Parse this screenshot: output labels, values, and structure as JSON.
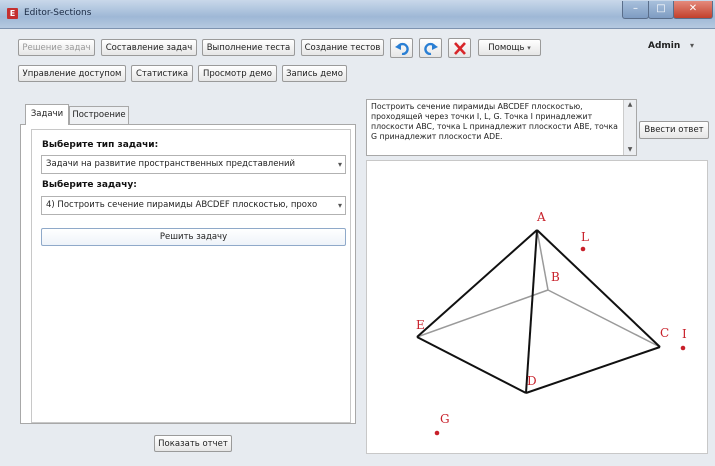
{
  "window": {
    "title": "Editor-Sections"
  },
  "toolbar": {
    "buttons": [
      {
        "label": "Решение задач",
        "enabled": false
      },
      {
        "label": "Составление задач",
        "enabled": true
      },
      {
        "label": "Выполнение теста",
        "enabled": true
      },
      {
        "label": "Создание тестов",
        "enabled": true
      }
    ],
    "help_label": "Помощь",
    "user_label": "Admin",
    "row2": [
      "Управление доступом",
      "Статистика",
      "Просмотр демо",
      "Запись демо"
    ]
  },
  "tabs": [
    {
      "label": "Задачи",
      "active": true
    },
    {
      "label": "Построение",
      "active": false
    }
  ],
  "task_panel": {
    "type_label": "Выберите тип задачи:",
    "type_value": "Задачи на развитие пространственных представлений",
    "task_label": "Выберите задачу:",
    "task_value": "4)  Построить сечение пирамиды ABCDEF плоскостью, прохо",
    "solve_label": "Решить задачу",
    "report_label": "Показать отчет"
  },
  "problem": {
    "text": "Построить сечение пирамиды ABCDEF плоскостью, проходящей через точки I, L, G. Точка I принадлежит плоскости ABC, точка L принадлежит плоскости ABE, точка G принадлежит плоскости ADE.",
    "answer_button": "Ввести ответ"
  },
  "figure": {
    "vertices": {
      "A": "A",
      "B": "B",
      "C": "C",
      "D": "D",
      "E": "E"
    },
    "points": {
      "L": "L",
      "I": "I",
      "G": "G"
    },
    "edge_color": "#111111",
    "hidden_edge_color": "#9a9a9a",
    "point_color": "#c8202a"
  }
}
